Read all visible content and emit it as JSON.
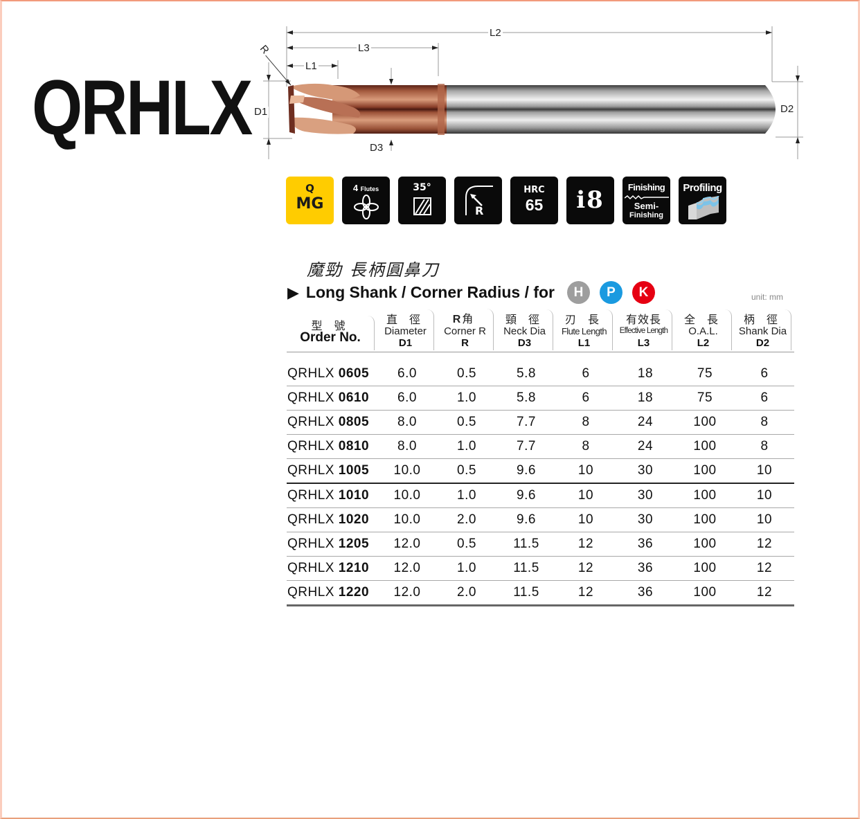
{
  "product": {
    "code": "QRHLX",
    "title_cn": "魔勁 長柄圓鼻刀",
    "title_en": "Long Shank / Corner Radius / for",
    "unit": "unit: mm"
  },
  "drawing": {
    "labels": {
      "R": "R",
      "L1": "L1",
      "L2": "L2",
      "L3": "L3",
      "D1": "D1",
      "D2": "D2",
      "D3": "D3"
    }
  },
  "feature_icons": [
    {
      "name": "qmg-grade",
      "line1": "Q",
      "line2": "MG",
      "color": "#ffcc00"
    },
    {
      "name": "flutes",
      "line1": "4",
      "line1_suffix": "Flutes"
    },
    {
      "name": "helix-angle",
      "line1": "35°"
    },
    {
      "name": "corner-radius",
      "line1": "R"
    },
    {
      "name": "hardness",
      "line1": "HRC",
      "line2": "65"
    },
    {
      "name": "i8",
      "line1": "i8"
    },
    {
      "name": "finishing",
      "line1": "Finishing",
      "line2": "Semi-",
      "line3": "Finishing"
    },
    {
      "name": "profiling",
      "line1": "Profiling"
    }
  ],
  "materials": [
    {
      "letter": "H",
      "color": "#9e9e9e"
    },
    {
      "letter": "P",
      "color": "#1a9ae0"
    },
    {
      "letter": "K",
      "color": "#e60012"
    }
  ],
  "table": {
    "headers": [
      {
        "cn": "型 號",
        "en": "Order No.",
        "code": ""
      },
      {
        "cn": "直 徑",
        "en": "Diameter",
        "code": "D1"
      },
      {
        "cn_bold": "R",
        "cn": "角",
        "en": "Corner R",
        "code": "R"
      },
      {
        "cn": "頸 徑",
        "en": "Neck Dia",
        "code": "D3"
      },
      {
        "cn": "刃 長",
        "en": "Flute Length",
        "code": "L1"
      },
      {
        "cn": "有效長",
        "en": "Effective Length",
        "code": "L3"
      },
      {
        "cn": "全 長",
        "en": "O.A.L.",
        "code": "L2"
      },
      {
        "cn": "柄 徑",
        "en": "Shank Dia",
        "code": "D2"
      }
    ],
    "rows": [
      {
        "prefix": "QRHLX",
        "num": "0605",
        "d1": "6.0",
        "r": "0.5",
        "d3": "5.8",
        "l1": "6",
        "l3": "18",
        "l2": "75",
        "d2": "6"
      },
      {
        "prefix": "QRHLX",
        "num": "0610",
        "d1": "6.0",
        "r": "1.0",
        "d3": "5.8",
        "l1": "6",
        "l3": "18",
        "l2": "75",
        "d2": "6"
      },
      {
        "prefix": "QRHLX",
        "num": "0805",
        "d1": "8.0",
        "r": "0.5",
        "d3": "7.7",
        "l1": "8",
        "l3": "24",
        "l2": "100",
        "d2": "8"
      },
      {
        "prefix": "QRHLX",
        "num": "0810",
        "d1": "8.0",
        "r": "1.0",
        "d3": "7.7",
        "l1": "8",
        "l3": "24",
        "l2": "100",
        "d2": "8"
      },
      {
        "prefix": "QRHLX",
        "num": "1005",
        "d1": "10.0",
        "r": "0.5",
        "d3": "9.6",
        "l1": "10",
        "l3": "30",
        "l2": "100",
        "d2": "10"
      },
      {
        "prefix": "QRHLX",
        "num": "1010",
        "d1": "10.0",
        "r": "1.0",
        "d3": "9.6",
        "l1": "10",
        "l3": "30",
        "l2": "100",
        "d2": "10"
      },
      {
        "prefix": "QRHLX",
        "num": "1020",
        "d1": "10.0",
        "r": "2.0",
        "d3": "9.6",
        "l1": "10",
        "l3": "30",
        "l2": "100",
        "d2": "10"
      },
      {
        "prefix": "QRHLX",
        "num": "1205",
        "d1": "12.0",
        "r": "0.5",
        "d3": "11.5",
        "l1": "12",
        "l3": "36",
        "l2": "100",
        "d2": "12"
      },
      {
        "prefix": "QRHLX",
        "num": "1210",
        "d1": "12.0",
        "r": "1.0",
        "d3": "11.5",
        "l1": "12",
        "l3": "36",
        "l2": "100",
        "d2": "12"
      },
      {
        "prefix": "QRHLX",
        "num": "1220",
        "d1": "12.0",
        "r": "2.0",
        "d3": "11.5",
        "l1": "12",
        "l3": "36",
        "l2": "100",
        "d2": "12"
      }
    ]
  }
}
